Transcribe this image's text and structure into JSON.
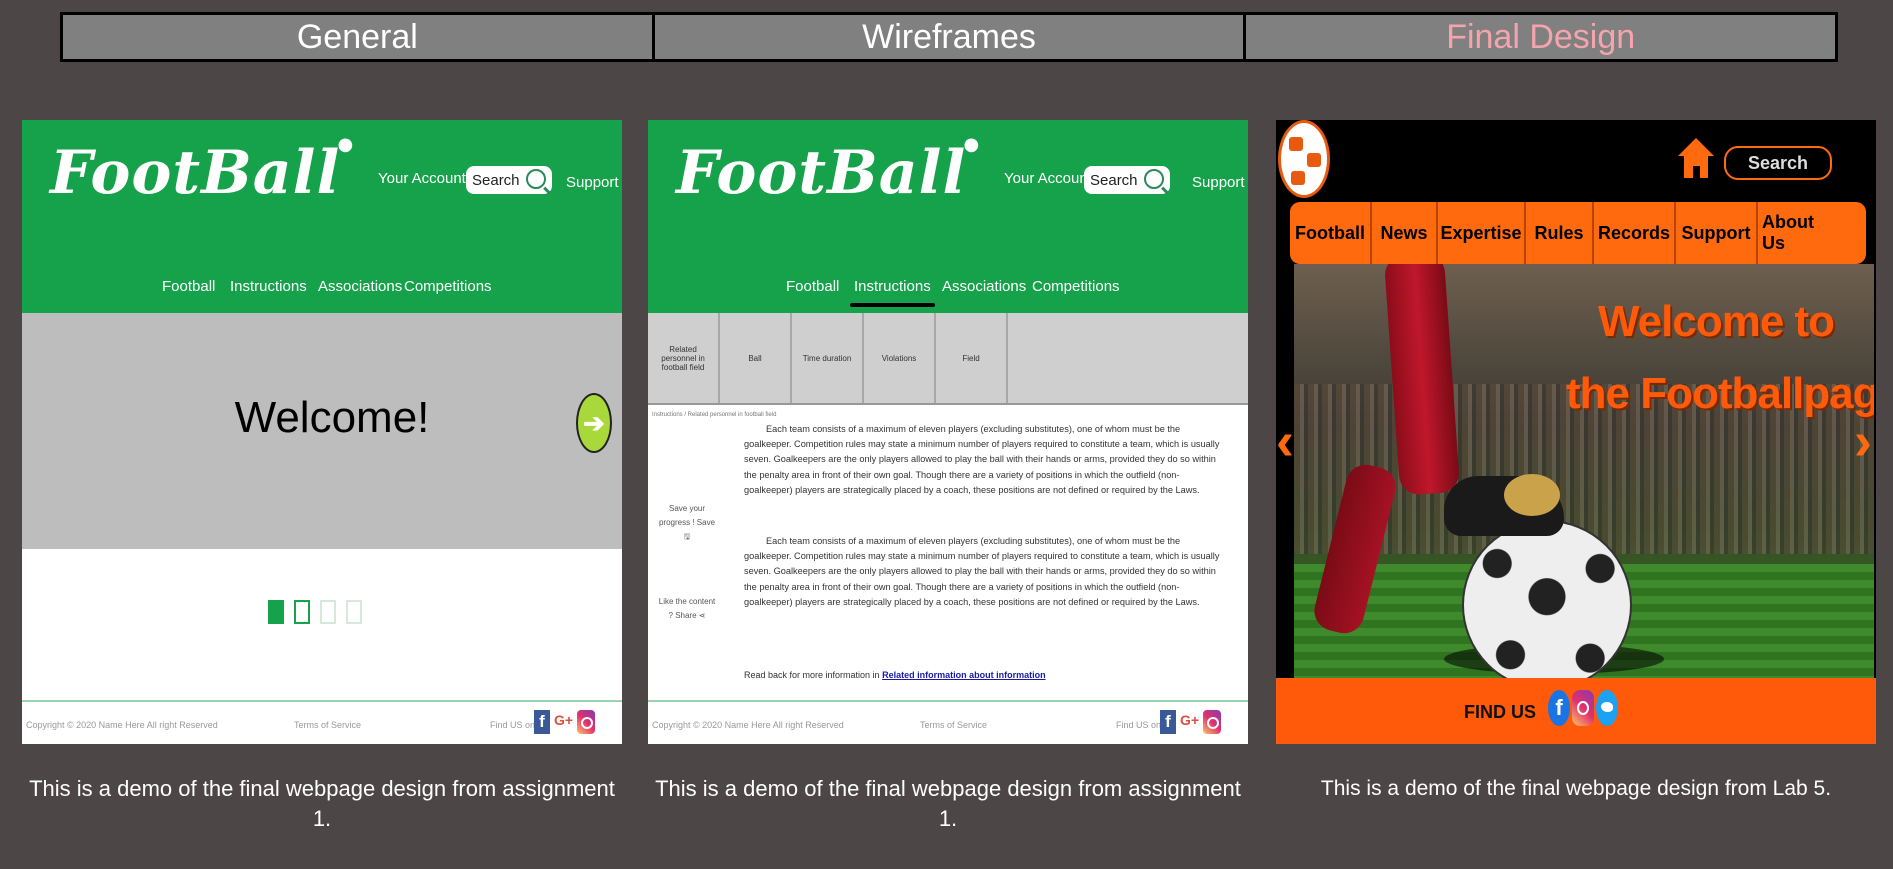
{
  "tabs": [
    {
      "label": "General"
    },
    {
      "label": "Wireframes"
    },
    {
      "label": "Final Design"
    }
  ],
  "accent_color": "#f4a4ac",
  "panels": {
    "general": {
      "logo": "FootBall",
      "account": "Your Account",
      "search": "Search",
      "support": "Support",
      "nav": [
        "Football",
        "Instructions",
        "Associations",
        "Competitions"
      ],
      "welcome": "Welcome!",
      "footer": {
        "copyright": "Copyright © 2020 Name Here All right Reserved",
        "terms": "Terms of Service",
        "find_us": "Find US on:"
      },
      "caption": "This is a demo of the final webpage design from assignment 1."
    },
    "wireframes": {
      "logo": "FootBall",
      "account": "Your Account",
      "search": "Search",
      "support": "Support",
      "nav": [
        "Football",
        "Instructions",
        "Associations",
        "Competitions"
      ],
      "columns": [
        "Related personnel in football field",
        "Ball",
        "Time duration",
        "Violations",
        "Field"
      ],
      "breadcrumb": "Instructions / Related personnel in football field",
      "save_label": "Save your progress ! Save",
      "like_label": "Like the content ? Share",
      "paragraph": "Each team consists of a maximum of eleven players (excluding substitutes), one of whom must be the goalkeeper. Competition rules may state a minimum number of players required to constitute a team, which is usually seven. Goalkeepers are the only players allowed to play the ball with their hands or arms, provided they do so within the penalty area in front of their own goal. Though there are a variety of positions in which the outfield (non-goalkeeper) players are strategically placed by a coach, these positions are not defined or required by the Laws.",
      "read_more": "Read back for more information in ",
      "read_more_link": "Related information about information",
      "footer": {
        "copyright": "Copyright © 2020 Name Here All right Reserved",
        "terms": "Terms of Service",
        "find_us": "Find US on:"
      },
      "caption": "This is a demo of the final webpage design from assignment 1."
    },
    "final": {
      "search": "Search",
      "nav": [
        "Football",
        "News",
        "Expertise",
        "Rules",
        "Records",
        "Support",
        "About Us"
      ],
      "welcome_line1": "Welcome to",
      "welcome_line2": "the Footballpage!",
      "find_us": "FIND US",
      "caption": "This is a demo of the final webpage design from Lab 5."
    }
  }
}
